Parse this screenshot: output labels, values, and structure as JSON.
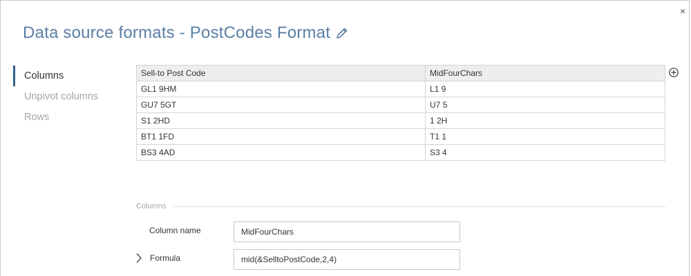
{
  "dialog": {
    "title": "Data source formats - PostCodes Format",
    "close_glyph": "×",
    "edit_icon": "pencil-icon"
  },
  "nav": {
    "items": [
      {
        "label": "Columns",
        "active": true
      },
      {
        "label": "Unpivot columns",
        "active": false
      },
      {
        "label": "Rows",
        "active": false
      }
    ]
  },
  "grid": {
    "columns": [
      "Sell-to Post Code",
      "MidFourChars"
    ],
    "rows": [
      [
        "GL1 9HM",
        "L1 9"
      ],
      [
        "GU7 5GT",
        "U7 5"
      ],
      [
        "S1 2HD",
        "1 2H"
      ],
      [
        "BT1 1FD",
        "T1 1"
      ],
      [
        "BS3 4AD",
        "S3 4"
      ]
    ],
    "add_icon": "plus-circle-icon"
  },
  "columns_section": {
    "header": "Columns",
    "column_name_label": "Column name",
    "column_name_value": "MidFourChars",
    "formula_label": "Formula",
    "formula_value": "mid(&SelltoPostCode,2,4)"
  },
  "colors": {
    "title": "#5b7fa6",
    "nav_active_bar": "#2f5f8a",
    "header_bg": "#eeeeee"
  }
}
